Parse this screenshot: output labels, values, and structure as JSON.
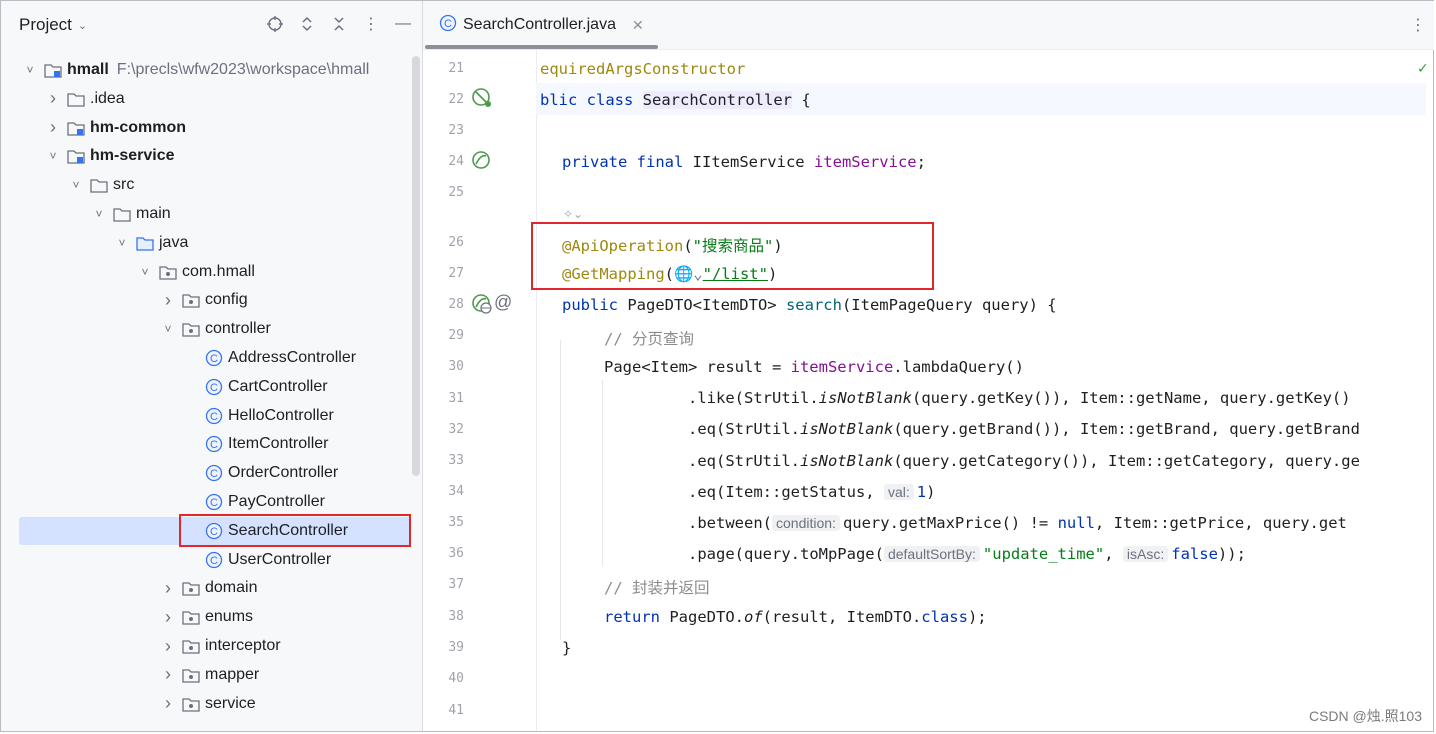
{
  "project_panel": {
    "title": "Project",
    "tree": [
      {
        "label": "hmall",
        "path": "F:\\precls\\wfw2023\\workspace\\hmall",
        "type": "module",
        "expanded": true,
        "bold": true
      },
      {
        "label": ".idea",
        "type": "folder",
        "expanded": false
      },
      {
        "label": "hm-common",
        "type": "module",
        "expanded": false,
        "bold": true
      },
      {
        "label": "hm-service",
        "type": "module",
        "expanded": true,
        "bold": true
      },
      {
        "label": "src",
        "type": "folder",
        "expanded": true
      },
      {
        "label": "main",
        "type": "folder",
        "expanded": true
      },
      {
        "label": "java",
        "type": "source-folder",
        "expanded": true
      },
      {
        "label": "com.hmall",
        "type": "package",
        "expanded": true
      },
      {
        "label": "config",
        "type": "package",
        "expanded": false
      },
      {
        "label": "controller",
        "type": "package",
        "expanded": true
      },
      {
        "label": "AddressController",
        "type": "class"
      },
      {
        "label": "CartController",
        "type": "class"
      },
      {
        "label": "HelloController",
        "type": "class"
      },
      {
        "label": "ItemController",
        "type": "class"
      },
      {
        "label": "OrderController",
        "type": "class"
      },
      {
        "label": "PayController",
        "type": "class"
      },
      {
        "label": "SearchController",
        "type": "class",
        "selected": true
      },
      {
        "label": "UserController",
        "type": "class"
      },
      {
        "label": "domain",
        "type": "package",
        "expanded": false
      },
      {
        "label": "enums",
        "type": "package",
        "expanded": false
      },
      {
        "label": "interceptor",
        "type": "package",
        "expanded": false
      },
      {
        "label": "mapper",
        "type": "package",
        "expanded": false
      },
      {
        "label": "service",
        "type": "package",
        "expanded": false
      }
    ]
  },
  "editor": {
    "tab_label": "SearchController.java",
    "line_numbers": [
      "21",
      "22",
      "23",
      "24",
      "25",
      "26",
      "27",
      "28",
      "29",
      "30",
      "31",
      "32",
      "33",
      "34",
      "35",
      "36",
      "37",
      "38",
      "39",
      "40",
      "41"
    ],
    "lines": {
      "l21": "equiredArgsConstructor",
      "l22a": "blic ",
      "l22b": "class ",
      "l22c": "SearchController",
      "l22d": " {",
      "l24a": "private final ",
      "l24b": "IItemService ",
      "l24c": "itemService",
      "l24d": ";",
      "l26a": "@ApiOperation",
      "l26b": "(",
      "l26c": "\"搜索商品\"",
      "l26d": ")",
      "l27a": "@GetMapping",
      "l27b": "(",
      "l27c": "\"/list\"",
      "l27d": ")",
      "l28a": "public ",
      "l28b": "PageDTO<ItemDTO> ",
      "l28c": "search",
      "l28d": "(ItemPageQuery query) {",
      "l29": "// 分页查询",
      "l30a": "Page<Item> result = ",
      "l30b": "itemService",
      "l30c": ".lambdaQuery()",
      "l31a": ".like(StrUtil.",
      "l31b": "isNotBlank",
      "l31c": "(query.getKey()), Item::getName, query.getKey()",
      "l32a": ".eq(StrUtil.",
      "l32b": "isNotBlank",
      "l32c": "(query.getBrand()), Item::getBrand, query.getBrand",
      "l33a": ".eq(StrUtil.",
      "l33b": "isNotBlank",
      "l33c": "(query.getCategory()), Item::getCategory, query.ge",
      "l34a": ".eq(Item::getStatus, ",
      "l34hint": "val:",
      "l34b": "1",
      "l34c": ")",
      "l35a": ".between(",
      "l35hint": "condition:",
      "l35b": "query.getMaxPrice() != ",
      "l35c": "null",
      "l35d": ", Item::getPrice, query.get",
      "l36a": ".page(query.toMpPage(",
      "l36hint1": "defaultSortBy:",
      "l36b": "\"update_time\"",
      "l36c": ", ",
      "l36hint2": "isAsc:",
      "l36d": "false",
      "l36e": "));",
      "l37": "// 封装并返回",
      "l38a": "return ",
      "l38b": "PageDTO.",
      "l38c": "of",
      "l38d": "(result, ItemDTO.",
      "l38e": "class",
      "l38f": ");",
      "l39": "}"
    }
  },
  "watermark": "CSDN @烛.照103",
  "colors": {
    "highlight_box": "#e3262c",
    "selection": "#d4e2ff",
    "keyword": "#0033b3",
    "annotation": "#9e880d",
    "string": "#067d17"
  }
}
